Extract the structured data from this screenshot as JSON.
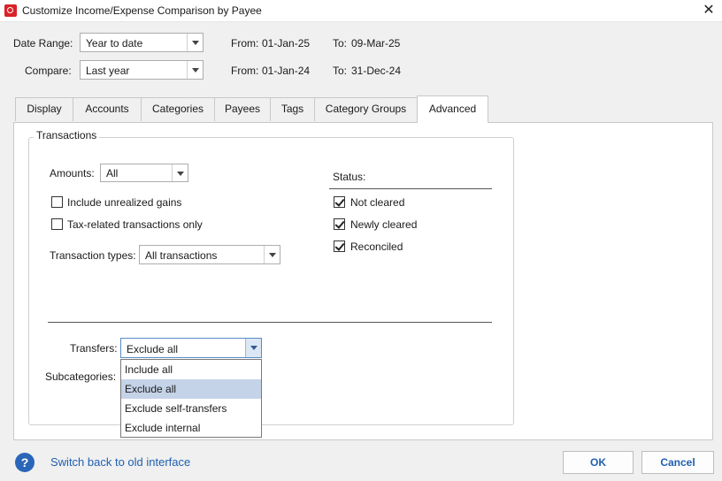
{
  "window": {
    "title": "Customize Income/Expense Comparison by Payee"
  },
  "date_range": {
    "label": "Date Range:",
    "value": "Year to date",
    "from_label": "From:",
    "from": "01-Jan-25",
    "to_label": "To:",
    "to": "09-Mar-25"
  },
  "compare": {
    "label": "Compare:",
    "value": "Last year",
    "from_label": "From:",
    "from": "01-Jan-24",
    "to_label": "To:",
    "to": "31-Dec-24"
  },
  "tabs": [
    {
      "label": "Display"
    },
    {
      "label": "Accounts"
    },
    {
      "label": "Categories"
    },
    {
      "label": "Payees"
    },
    {
      "label": "Tags"
    },
    {
      "label": "Category Groups"
    },
    {
      "label": "Advanced",
      "active": true
    }
  ],
  "transactions": {
    "group_label": "Transactions",
    "amounts_label": "Amounts:",
    "amounts_value": "All",
    "include_unrealized": {
      "label": "Include unrealized gains",
      "checked": false
    },
    "tax_related": {
      "label": "Tax-related transactions only",
      "checked": false
    },
    "types_label": "Transaction types:",
    "types_value": "All transactions",
    "status": {
      "label": "Status:",
      "items": [
        {
          "label": "Not cleared",
          "checked": true
        },
        {
          "label": "Newly cleared",
          "checked": true
        },
        {
          "label": "Reconciled",
          "checked": true
        }
      ]
    },
    "transfers_label": "Transfers:",
    "transfers_value": "Exclude all",
    "subcategories_label": "Subcategories:",
    "transfers_options": [
      {
        "label": "Include all"
      },
      {
        "label": "Exclude all",
        "selected": true
      },
      {
        "label": "Exclude self-transfers"
      },
      {
        "label": "Exclude internal"
      }
    ]
  },
  "footer": {
    "help_icon_glyph": "?",
    "switch_link": "Switch back to old interface",
    "ok_label": "OK",
    "cancel_label": "Cancel"
  },
  "colors": {
    "brand": "#d8232a",
    "link": "#1f5fb0",
    "selection": "#c5d3e8"
  }
}
